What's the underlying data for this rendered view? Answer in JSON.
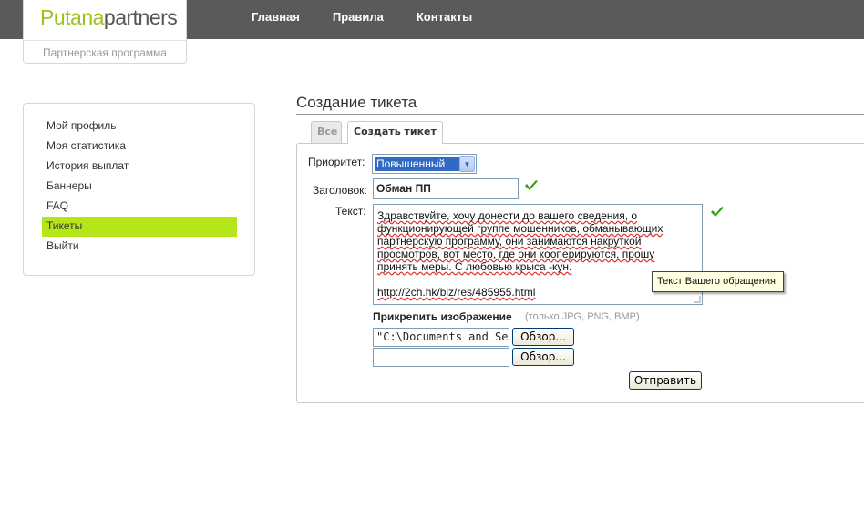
{
  "header": {
    "logo_part1": "Putana",
    "logo_part2": "partners",
    "tagline": "Партнерская программа",
    "nav": [
      "Главная",
      "Правила",
      "Контакты"
    ]
  },
  "sidebar": {
    "items": [
      {
        "label": "Мой профиль",
        "active": false
      },
      {
        "label": "Моя статистика",
        "active": false
      },
      {
        "label": "История выплат",
        "active": false
      },
      {
        "label": "Баннеры",
        "active": false
      },
      {
        "label": "FAQ",
        "active": false
      },
      {
        "label": "Тикеты",
        "active": true
      },
      {
        "label": "Выйти",
        "active": false
      }
    ],
    "active_color": "#b5e619"
  },
  "main": {
    "title": "Создание тикета",
    "tabs": [
      {
        "label": "Все",
        "active": false
      },
      {
        "label": "Создать тикет",
        "active": true
      }
    ]
  },
  "form": {
    "priority_label": "Приоритет:",
    "priority_value": "Повышенный",
    "subject_label": "Заголовок:",
    "subject_value": "Обман ПП",
    "text_label": "Текст:",
    "text_value": "Здравствуйте, хочу донести до вашего сведения, о функционирующей группе мошенников, обманывающих партнерскую программу, они занимаются накруткой просмотров, вот место, где они кооперируются, прошу принять меры. С любовью крыса -кун.",
    "text_link": "http://2ch.hk/biz/res/485955.html",
    "tooltip": "Текст Вашего обращения.",
    "attach_label": "Прикрепить изображение",
    "attach_hint": "(только JPG, PNG, BMP)",
    "file1_value": "\"C:\\Documents and Setti",
    "file2_value": "",
    "browse_label": "Обзор...",
    "submit_label": "Отправить",
    "valid_icon": "check-icon",
    "valid_color": "#3a9a1a"
  }
}
